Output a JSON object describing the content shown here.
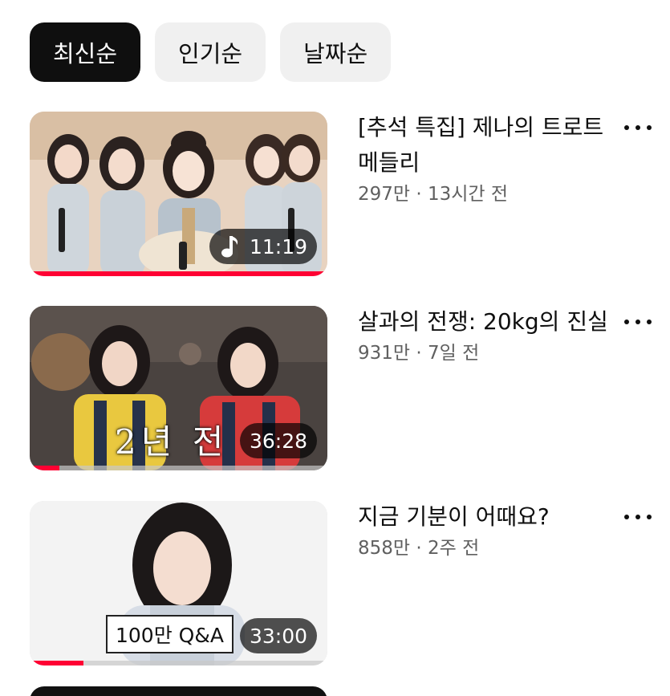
{
  "filters": {
    "chips": [
      {
        "label": "최신순",
        "active": true
      },
      {
        "label": "인기순",
        "active": false
      },
      {
        "label": "날짜순",
        "active": false
      }
    ]
  },
  "videos": [
    {
      "title": "[추석 특집] 제나의 트로트 메들리",
      "stats": "297만 · 13시간 전",
      "duration": "11:19",
      "duration_icon": "music-note-icon",
      "watched_fraction": 1.0
    },
    {
      "title": "살과의 전쟁: 20kg의 진실",
      "stats": "931만 · 7일 전",
      "duration": "36:28",
      "overlay_text": "2년 전",
      "watched_fraction": 0.1
    },
    {
      "title": "지금 기분이 어때요?",
      "stats": "858만 · 2주 전",
      "duration": "33:00",
      "overlay_text": "100만 Q&A",
      "watched_fraction": 0.18
    }
  ],
  "colors": {
    "progress": "#ff0033",
    "chip_active_bg": "#0f0f0f",
    "chip_bg": "#f0f0f0",
    "meta_text": "#606060"
  }
}
